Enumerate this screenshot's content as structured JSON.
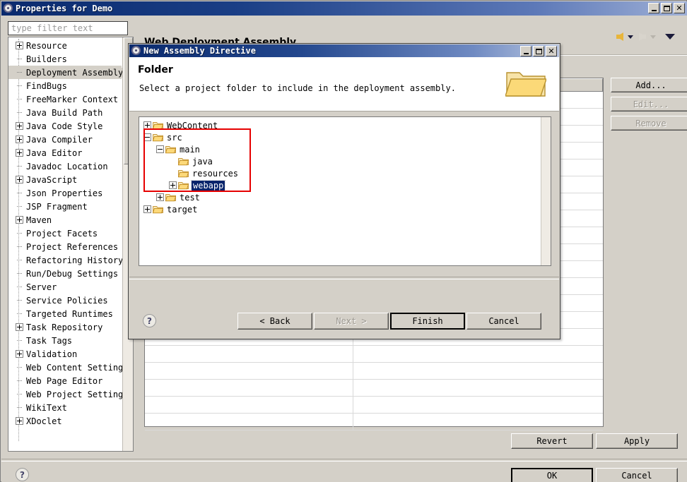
{
  "window": {
    "title": "Properties for Demo",
    "icon": "gear-icon",
    "minimize": "_",
    "maximize": "□",
    "close": "✕"
  },
  "filter": {
    "placeholder": "type filter text",
    "value": ""
  },
  "sidebar": {
    "items": [
      {
        "label": "Resource",
        "expandable": true,
        "selected": false
      },
      {
        "label": "Builders",
        "expandable": false,
        "selected": false
      },
      {
        "label": "Deployment Assembly",
        "expandable": false,
        "selected": true
      },
      {
        "label": "FindBugs",
        "expandable": false,
        "selected": false
      },
      {
        "label": "FreeMarker Context",
        "expandable": false,
        "selected": false
      },
      {
        "label": "Java Build Path",
        "expandable": false,
        "selected": false
      },
      {
        "label": "Java Code Style",
        "expandable": true,
        "selected": false
      },
      {
        "label": "Java Compiler",
        "expandable": true,
        "selected": false
      },
      {
        "label": "Java Editor",
        "expandable": true,
        "selected": false
      },
      {
        "label": "Javadoc Location",
        "expandable": false,
        "selected": false
      },
      {
        "label": "JavaScript",
        "expandable": true,
        "selected": false
      },
      {
        "label": "Json Properties",
        "expandable": false,
        "selected": false
      },
      {
        "label": "JSP Fragment",
        "expandable": false,
        "selected": false
      },
      {
        "label": "Maven",
        "expandable": true,
        "selected": false
      },
      {
        "label": "Project Facets",
        "expandable": false,
        "selected": false
      },
      {
        "label": "Project References",
        "expandable": false,
        "selected": false
      },
      {
        "label": "Refactoring History",
        "expandable": false,
        "selected": false
      },
      {
        "label": "Run/Debug Settings",
        "expandable": false,
        "selected": false
      },
      {
        "label": "Server",
        "expandable": false,
        "selected": false
      },
      {
        "label": "Service Policies",
        "expandable": false,
        "selected": false
      },
      {
        "label": "Targeted Runtimes",
        "expandable": false,
        "selected": false
      },
      {
        "label": "Task Repository",
        "expandable": true,
        "selected": false
      },
      {
        "label": "Task Tags",
        "expandable": false,
        "selected": false
      },
      {
        "label": "Validation",
        "expandable": true,
        "selected": false
      },
      {
        "label": "Web Content Settings",
        "expandable": false,
        "selected": false
      },
      {
        "label": "Web Page Editor",
        "expandable": false,
        "selected": false
      },
      {
        "label": "Web Project Settings",
        "expandable": false,
        "selected": false
      },
      {
        "label": "WikiText",
        "expandable": false,
        "selected": false
      },
      {
        "label": "XDoclet",
        "expandable": true,
        "selected": false
      }
    ]
  },
  "page": {
    "title": "Web Deployment Assembly",
    "nav": {
      "back_icon": "back-arrow-icon",
      "forward_icon": "forward-arrow-icon",
      "menu_icon": "chevron-down-icon"
    },
    "table": {
      "columns": [
        "",
        ""
      ],
      "rows": [
        [
          "",
          ""
        ],
        [
          "",
          ""
        ],
        [
          "",
          ""
        ],
        [
          "",
          ""
        ],
        [
          "",
          ""
        ],
        [
          "",
          ""
        ],
        [
          "",
          ""
        ],
        [
          "",
          ""
        ],
        [
          "",
          ""
        ],
        [
          "",
          ""
        ],
        [
          "",
          ""
        ],
        [
          "",
          ""
        ],
        [
          "",
          ""
        ],
        [
          "",
          ""
        ],
        [
          "",
          ""
        ],
        [
          "",
          ""
        ],
        [
          "",
          ""
        ],
        [
          "",
          ""
        ],
        [
          "",
          ""
        ],
        [
          "",
          ""
        ]
      ]
    },
    "side_buttons": [
      {
        "label": "Add...",
        "enabled": true
      },
      {
        "label": "Edit...",
        "enabled": false
      },
      {
        "label": "Remove",
        "enabled": false
      }
    ],
    "bottom_buttons": [
      {
        "label": "Revert",
        "enabled": true
      },
      {
        "label": "Apply",
        "enabled": true
      }
    ]
  },
  "footer": {
    "help_icon": "?",
    "ok": "OK",
    "cancel": "Cancel"
  },
  "dialog": {
    "title": "New Assembly Directive",
    "icon": "gear-icon",
    "minimize": "_",
    "maximize": "□",
    "close": "✕",
    "heading": "Folder",
    "description": "Select a project folder to include in the deployment assembly.",
    "banner_icon": "folder-icon",
    "tree": [
      {
        "label": "WebContent",
        "depth": 0,
        "state": "collapsed",
        "selected": false
      },
      {
        "label": "src",
        "depth": 0,
        "state": "expanded",
        "selected": false
      },
      {
        "label": "main",
        "depth": 1,
        "state": "expanded",
        "selected": false
      },
      {
        "label": "java",
        "depth": 2,
        "state": "leaf",
        "selected": false
      },
      {
        "label": "resources",
        "depth": 2,
        "state": "leaf",
        "selected": false
      },
      {
        "label": "webapp",
        "depth": 2,
        "state": "collapsed",
        "selected": true
      },
      {
        "label": "test",
        "depth": 1,
        "state": "collapsed",
        "selected": false
      },
      {
        "label": "target",
        "depth": 0,
        "state": "collapsed",
        "selected": false
      }
    ],
    "highlight_color": "#e60000",
    "selection_color": "#08246b",
    "help_icon": "?",
    "buttons": [
      {
        "label": "< Back",
        "enabled": true,
        "default": false
      },
      {
        "label": "Next >",
        "enabled": false,
        "default": false
      },
      {
        "label": "Finish",
        "enabled": true,
        "default": true
      },
      {
        "label": "Cancel",
        "enabled": true,
        "default": false
      }
    ]
  }
}
